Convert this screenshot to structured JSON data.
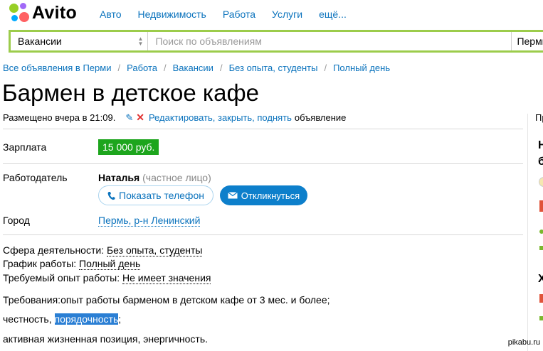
{
  "header": {
    "logo_text": "Avito",
    "nav": [
      "Авто",
      "Недвижимость",
      "Работа",
      "Услуги",
      "ещё..."
    ]
  },
  "search": {
    "category": "Вакансии",
    "placeholder": "Поиск по объявлениям",
    "city": "Пермь"
  },
  "breadcrumb": [
    "Все объявления в Перми",
    "Работа",
    "Вакансии",
    "Без опыта, студенты",
    "Полный день"
  ],
  "ad": {
    "title": "Бармен в детское кафе",
    "posted": "Размещено вчера в 21:09.",
    "edit_link": "Редактировать, закрыть, поднять",
    "edit_suffix": "объявление",
    "salary_label": "Зарплата",
    "salary": "15 000 руб.",
    "employer_label": "Работодатель",
    "employer_name": "Наталья",
    "employer_type": "(частное лицо)",
    "phone_button": "Показать телефон",
    "apply_button": "Откликнуться",
    "city_label": "Город",
    "city_value": "Пермь, р-н Ленинский",
    "details": [
      {
        "label": "Сфера деятельности:",
        "value": "Без опыта, студенты"
      },
      {
        "label": "График работы:",
        "value": "Полный день"
      },
      {
        "label": "Требуемый опыт работы:",
        "value": "Не имеет значения"
      }
    ],
    "req_line1": "Требования:опыт работы барменом в детском кафе от 3 мес. и более;",
    "req_line2_prefix": "честность,",
    "req_line2_highlight": "порядочность",
    "req_line2_suffix": ";",
    "req_line3": "активная жизненная позиция, энергичность."
  },
  "sidebar": {
    "fragments": [
      "Пр",
      "Н",
      "б",
      "Х"
    ]
  },
  "watermark": "pikabu.ru",
  "colors": {
    "accent_green": "#9ccc4b",
    "price_green": "#1da51d",
    "link_blue": "#0b73bd",
    "button_blue": "#0d7fcb",
    "highlight": "#2b7fd4"
  }
}
